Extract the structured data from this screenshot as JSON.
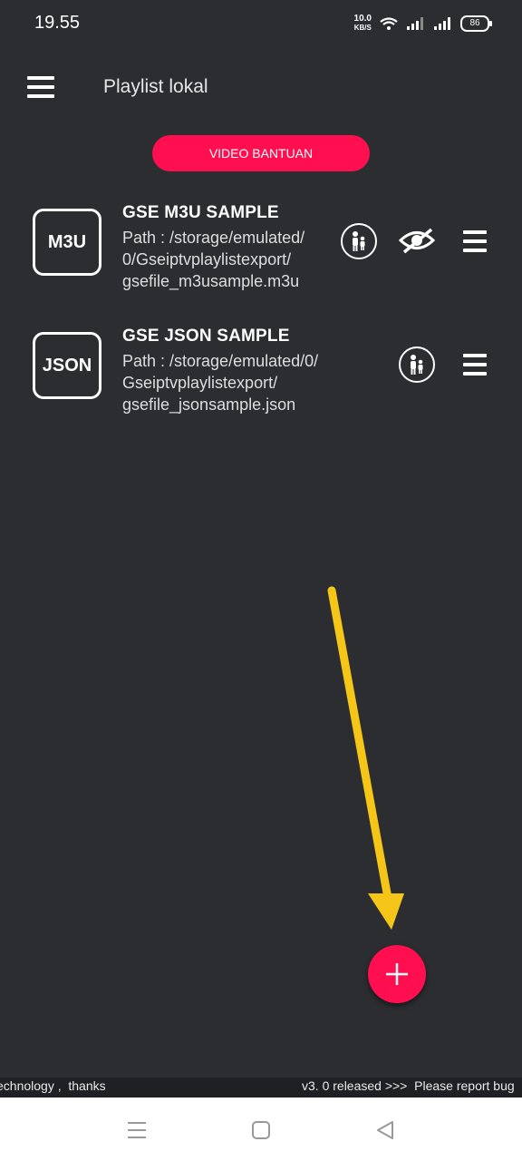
{
  "status": {
    "time": "19.55",
    "speed_top": "10.0",
    "speed_unit": "KB/S",
    "battery": "86"
  },
  "appbar": {
    "title": "Playlist lokal"
  },
  "help_button": "VIDEO BANTUAN",
  "playlists": [
    {
      "icon_label": "M3U",
      "title": "GSE M3U SAMPLE",
      "path": "Path : /storage/emulated/\n0/Gseiptvplaylistexport/\ngsefile_m3usample.m3u"
    },
    {
      "icon_label": "JSON",
      "title": "GSE JSON SAMPLE",
      "path": "Path : /storage/emulated/0/\nGseiptvplaylistexport/\ngsefile_jsonsample.json"
    }
  ],
  "ticker": {
    "left": "echnology ,  thanks",
    "right": "v3. 0 released >>>  Please report bug"
  },
  "colors": {
    "background": "#2b2d31",
    "accent": "#ff0f4f",
    "arrow": "#f5c518"
  },
  "icons": [
    "menu-icon",
    "family-icon",
    "eye-off-icon",
    "list-menu-icon",
    "plus-icon",
    "nav-recents-icon",
    "nav-home-icon",
    "nav-back-icon"
  ]
}
